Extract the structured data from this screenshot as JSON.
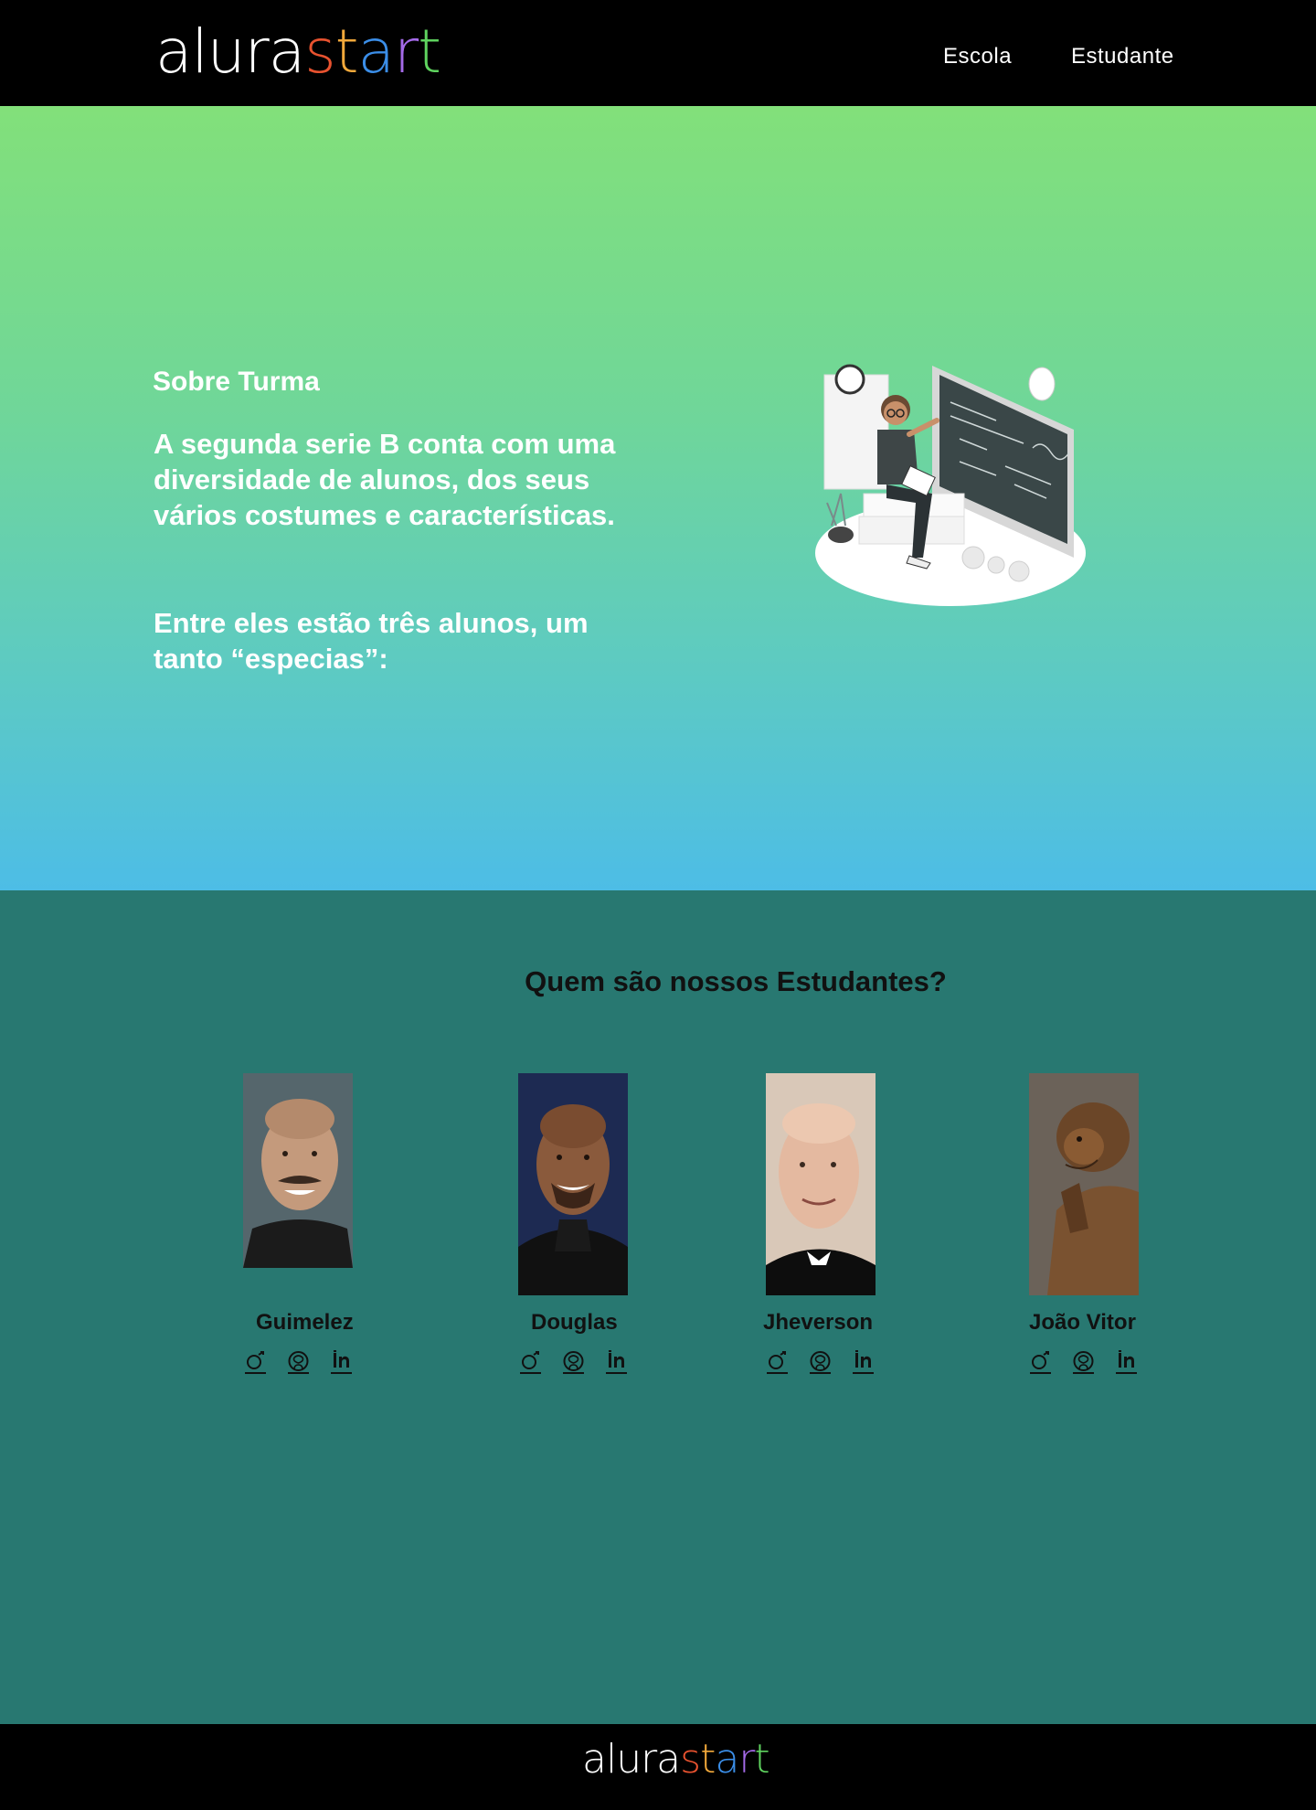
{
  "brand": {
    "part1": "alura",
    "part2_letters": [
      {
        "ch": "s",
        "color": "#e8522f"
      },
      {
        "ch": "t",
        "color": "#f2a93b"
      },
      {
        "ch": "a",
        "color": "#3b8ee8"
      },
      {
        "ch": "r",
        "color": "#a46ae8"
      },
      {
        "ch": "t",
        "color": "#5fd35f"
      }
    ]
  },
  "nav": {
    "escola": "Escola",
    "estudante": "Estudante"
  },
  "hero": {
    "title": "Sobre Turma",
    "paragraph1": "A segunda serie B conta com uma diversidade de alunos, dos seus vários costumes e características.",
    "paragraph2": "Entre eles estão três alunos, um tanto “especias”:"
  },
  "students_section": {
    "title": "Quem são nossos Estudantes?",
    "students": [
      {
        "name": "Guimelez",
        "skin": "#c49a7c",
        "bg": "#5a6b70",
        "shirt": "#1b1b1b"
      },
      {
        "name": "Douglas",
        "skin": "#8a5a3c",
        "bg": "#1d2a52",
        "shirt": "#111111"
      },
      {
        "name": "Jheverson",
        "skin": "#e4b9a0",
        "bg": "#d9c8b8",
        "shirt": "#0d0d0d"
      },
      {
        "name": "João Vitor",
        "skin": "#8a5b33",
        "bg": "#6b6259",
        "shirt": "#6b4628"
      }
    ],
    "social_icons": [
      "instagram-icon",
      "github-icon",
      "linkedin-icon"
    ]
  },
  "colors": {
    "header_bg": "#000000",
    "hero_gradient_top": "#82e07a",
    "hero_gradient_bottom": "#4dbde6",
    "students_bg": "#287871"
  }
}
